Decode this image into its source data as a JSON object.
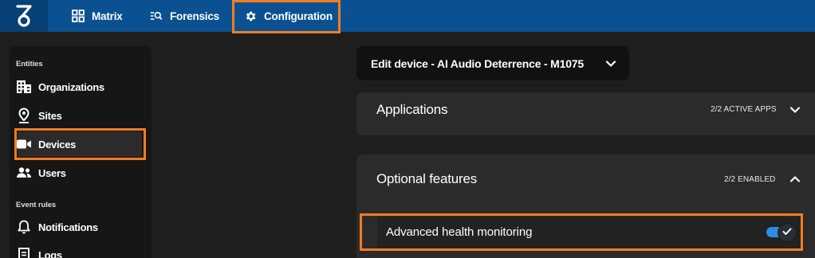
{
  "header": {
    "nav": [
      {
        "label": "Matrix",
        "icon": "grid-icon"
      },
      {
        "label": "Forensics",
        "icon": "search-list-icon"
      },
      {
        "label": "Configuration",
        "icon": "gear-icon"
      }
    ]
  },
  "sidebar": {
    "sections": [
      {
        "title": "Entities",
        "items": [
          {
            "label": "Organizations",
            "icon": "building-icon"
          },
          {
            "label": "Sites",
            "icon": "location-pin-icon"
          },
          {
            "label": "Devices",
            "icon": "video-camera-icon",
            "active": true
          },
          {
            "label": "Users",
            "icon": "users-icon"
          }
        ]
      },
      {
        "title": "Event rules",
        "items": [
          {
            "label": "Notifications",
            "icon": "bell-icon"
          },
          {
            "label": "Logs",
            "icon": "document-icon"
          }
        ]
      }
    ]
  },
  "main": {
    "edit_device_title": "Edit device - AI Audio Deterrence - M1075",
    "applications": {
      "title": "Applications",
      "status": "2/2 ACTIVE APPS"
    },
    "optional_features": {
      "title": "Optional features",
      "status": "2/2 ENABLED",
      "items": [
        {
          "label": "Advanced health monitoring",
          "enabled": true
        }
      ]
    }
  },
  "colors": {
    "topbar": "#0b5191",
    "highlight": "#f57c20",
    "toggle_on": "#2d8de0",
    "panel": "#2b2b2b",
    "background": "#1e1e1e"
  }
}
